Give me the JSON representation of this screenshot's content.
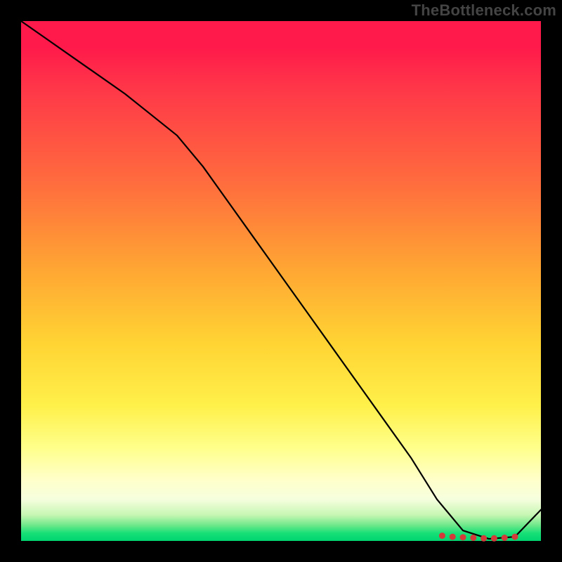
{
  "watermark": "TheBottleneck.com",
  "chart_data": {
    "type": "line",
    "title": "",
    "xlabel": "",
    "ylabel": "",
    "xlim": [
      0,
      100
    ],
    "ylim": [
      0,
      100
    ],
    "grid": false,
    "legend": false,
    "x": [
      0,
      5,
      10,
      15,
      20,
      25,
      30,
      35,
      40,
      45,
      50,
      55,
      60,
      65,
      70,
      75,
      80,
      85,
      90,
      95,
      100
    ],
    "values": [
      100,
      96.5,
      93,
      89.5,
      86,
      82,
      78,
      72,
      65,
      58,
      51,
      44,
      37,
      30,
      23,
      16,
      8,
      2,
      0.4,
      0.8,
      6
    ],
    "markers": {
      "x": [
        81,
        83,
        85,
        87,
        89,
        91,
        93,
        95
      ],
      "y": [
        1.0,
        0.8,
        0.7,
        0.6,
        0.5,
        0.5,
        0.6,
        0.8
      ]
    },
    "background_gradient": {
      "top": "#ff1a4b",
      "mid_upper": "#ffa733",
      "mid": "#fff04a",
      "lower": "#ffffc8",
      "bottom": "#00d470"
    }
  }
}
